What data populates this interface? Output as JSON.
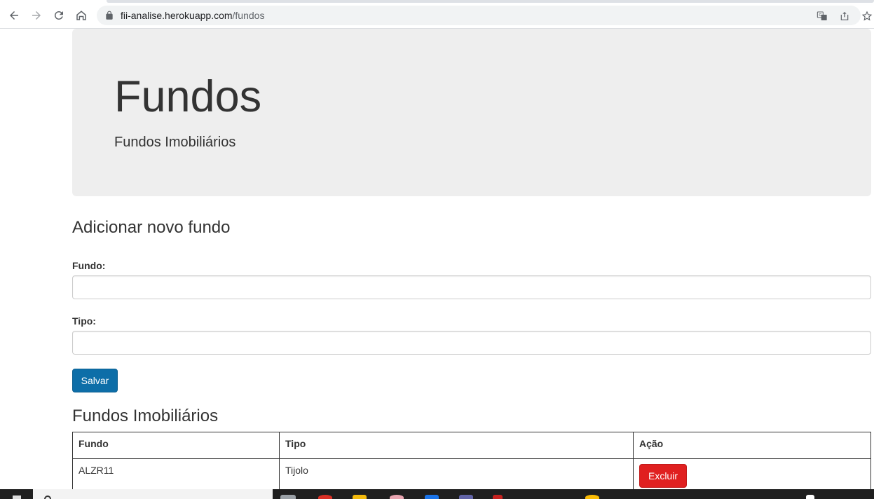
{
  "browser": {
    "url_host": "fii-analise.herokuapp.com",
    "url_path": "/fundos"
  },
  "jumbotron": {
    "title": "Fundos",
    "subtitle": "Fundos Imobiliários"
  },
  "form": {
    "heading": "Adicionar novo fundo",
    "fundo_label": "Fundo:",
    "fundo_value": "",
    "tipo_label": "Tipo:",
    "tipo_value": "",
    "save_label": "Salvar"
  },
  "table": {
    "heading": "Fundos Imobiliários",
    "columns": [
      "Fundo",
      "Tipo",
      "Ação"
    ],
    "rows": [
      {
        "fundo": "ALZR11",
        "tipo": "Tijolo",
        "action_label": "Excluir"
      }
    ]
  },
  "colors": {
    "primary_button": "#0d6ea8",
    "danger_button": "#e02020",
    "jumbotron_bg": "#eeeeee"
  },
  "icons": {
    "back": "back-arrow-icon",
    "forward": "forward-arrow-icon",
    "reload": "reload-icon",
    "home": "home-icon",
    "lock": "lock-icon",
    "translate": "translate-icon",
    "share": "share-icon",
    "bookmark": "star-icon"
  }
}
